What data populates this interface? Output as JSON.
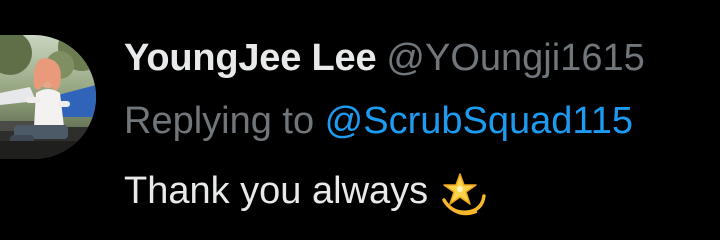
{
  "tweet": {
    "author": {
      "display_name": "YoungJee Lee",
      "handle": "@YOungji1615"
    },
    "reply": {
      "prefix": "Replying to ",
      "target": "@ScrubSquad115"
    },
    "text": "Thank you always",
    "emoji": "dizzy-star-emoji"
  },
  "colors": {
    "background": "#000000",
    "primary_text": "#e7e9ea",
    "secondary_text": "#71767b",
    "link": "#1d9bf0"
  }
}
